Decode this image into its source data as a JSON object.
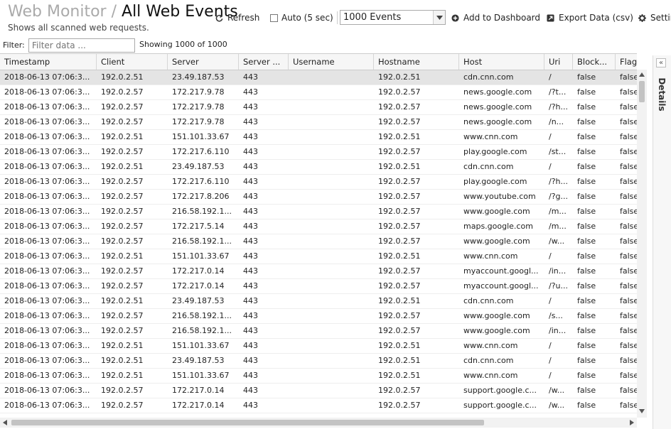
{
  "header": {
    "breadcrumb": "Web Monitor",
    "separator": "/",
    "title": "All Web Events",
    "subtitle": "Shows all scanned web requests."
  },
  "toolbar": {
    "refresh_label": "Refresh",
    "auto_label": "Auto (5 sec)",
    "events_select_value": "1000 Events",
    "add_dashboard_label": "Add to Dashboard",
    "export_label": "Export Data (csv)",
    "settings_label": "Settings"
  },
  "filter": {
    "label": "Filter:",
    "placeholder": "Filter data ...",
    "showing": "Showing 1000 of 1000"
  },
  "columns": [
    "Timestamp",
    "Client",
    "Server",
    "Server ...",
    "Username",
    "Hostname",
    "Host",
    "Uri",
    "Block...",
    "Flagg..."
  ],
  "rows": [
    [
      "2018-06-13 07:06:3...",
      "192.0.2.51",
      "23.49.187.53",
      "443",
      "",
      "192.0.2.51",
      "cdn.cnn.com",
      "/",
      "false",
      "false"
    ],
    [
      "2018-06-13 07:06:3...",
      "192.0.2.57",
      "172.217.9.78",
      "443",
      "",
      "192.0.2.57",
      "news.google.com",
      "/?t...",
      "false",
      "false"
    ],
    [
      "2018-06-13 07:06:3...",
      "192.0.2.57",
      "172.217.9.78",
      "443",
      "",
      "192.0.2.57",
      "news.google.com",
      "/?h...",
      "false",
      "false"
    ],
    [
      "2018-06-13 07:06:3...",
      "192.0.2.57",
      "172.217.9.78",
      "443",
      "",
      "192.0.2.57",
      "news.google.com",
      "/n...",
      "false",
      "false"
    ],
    [
      "2018-06-13 07:06:3...",
      "192.0.2.51",
      "151.101.33.67",
      "443",
      "",
      "192.0.2.51",
      "www.cnn.com",
      "/",
      "false",
      "false"
    ],
    [
      "2018-06-13 07:06:3...",
      "192.0.2.57",
      "172.217.6.110",
      "443",
      "",
      "192.0.2.57",
      "play.google.com",
      "/st...",
      "false",
      "false"
    ],
    [
      "2018-06-13 07:06:3...",
      "192.0.2.51",
      "23.49.187.53",
      "443",
      "",
      "192.0.2.51",
      "cdn.cnn.com",
      "/",
      "false",
      "false"
    ],
    [
      "2018-06-13 07:06:3...",
      "192.0.2.57",
      "172.217.6.110",
      "443",
      "",
      "192.0.2.57",
      "play.google.com",
      "/?h...",
      "false",
      "false"
    ],
    [
      "2018-06-13 07:06:3...",
      "192.0.2.57",
      "172.217.8.206",
      "443",
      "",
      "192.0.2.57",
      "www.youtube.com",
      "/?g...",
      "false",
      "false"
    ],
    [
      "2018-06-13 07:06:3...",
      "192.0.2.57",
      "216.58.192.1...",
      "443",
      "",
      "192.0.2.57",
      "www.google.com",
      "/m...",
      "false",
      "false"
    ],
    [
      "2018-06-13 07:06:3...",
      "192.0.2.57",
      "172.217.5.14",
      "443",
      "",
      "192.0.2.57",
      "maps.google.com",
      "/m...",
      "false",
      "false"
    ],
    [
      "2018-06-13 07:06:3...",
      "192.0.2.57",
      "216.58.192.1...",
      "443",
      "",
      "192.0.2.57",
      "www.google.com",
      "/w...",
      "false",
      "false"
    ],
    [
      "2018-06-13 07:06:3...",
      "192.0.2.51",
      "151.101.33.67",
      "443",
      "",
      "192.0.2.51",
      "www.cnn.com",
      "/",
      "false",
      "false"
    ],
    [
      "2018-06-13 07:06:3...",
      "192.0.2.57",
      "172.217.0.14",
      "443",
      "",
      "192.0.2.57",
      "myaccount.googl...",
      "/in...",
      "false",
      "false"
    ],
    [
      "2018-06-13 07:06:3...",
      "192.0.2.57",
      "172.217.0.14",
      "443",
      "",
      "192.0.2.57",
      "myaccount.googl...",
      "/?u...",
      "false",
      "false"
    ],
    [
      "2018-06-13 07:06:3...",
      "192.0.2.51",
      "23.49.187.53",
      "443",
      "",
      "192.0.2.51",
      "cdn.cnn.com",
      "/",
      "false",
      "false"
    ],
    [
      "2018-06-13 07:06:3...",
      "192.0.2.57",
      "216.58.192.1...",
      "443",
      "",
      "192.0.2.57",
      "www.google.com",
      "/s...",
      "false",
      "false"
    ],
    [
      "2018-06-13 07:06:3...",
      "192.0.2.57",
      "216.58.192.1...",
      "443",
      "",
      "192.0.2.57",
      "www.google.com",
      "/in...",
      "false",
      "false"
    ],
    [
      "2018-06-13 07:06:3...",
      "192.0.2.51",
      "151.101.33.67",
      "443",
      "",
      "192.0.2.51",
      "www.cnn.com",
      "/",
      "false",
      "false"
    ],
    [
      "2018-06-13 07:06:3...",
      "192.0.2.51",
      "23.49.187.53",
      "443",
      "",
      "192.0.2.51",
      "cdn.cnn.com",
      "/",
      "false",
      "false"
    ],
    [
      "2018-06-13 07:06:3...",
      "192.0.2.51",
      "151.101.33.67",
      "443",
      "",
      "192.0.2.51",
      "www.cnn.com",
      "/",
      "false",
      "false"
    ],
    [
      "2018-06-13 07:06:3...",
      "192.0.2.57",
      "172.217.0.14",
      "443",
      "",
      "192.0.2.57",
      "support.google.c...",
      "/w...",
      "false",
      "false"
    ],
    [
      "2018-06-13 07:06:3...",
      "192.0.2.57",
      "172.217.0.14",
      "443",
      "",
      "192.0.2.57",
      "support.google.c...",
      "/w...",
      "false",
      "false"
    ]
  ],
  "side_panel": {
    "label": "Details"
  },
  "colors": {
    "selected_row": "#e4e4e4",
    "header_bg": "#f6f6f6"
  }
}
